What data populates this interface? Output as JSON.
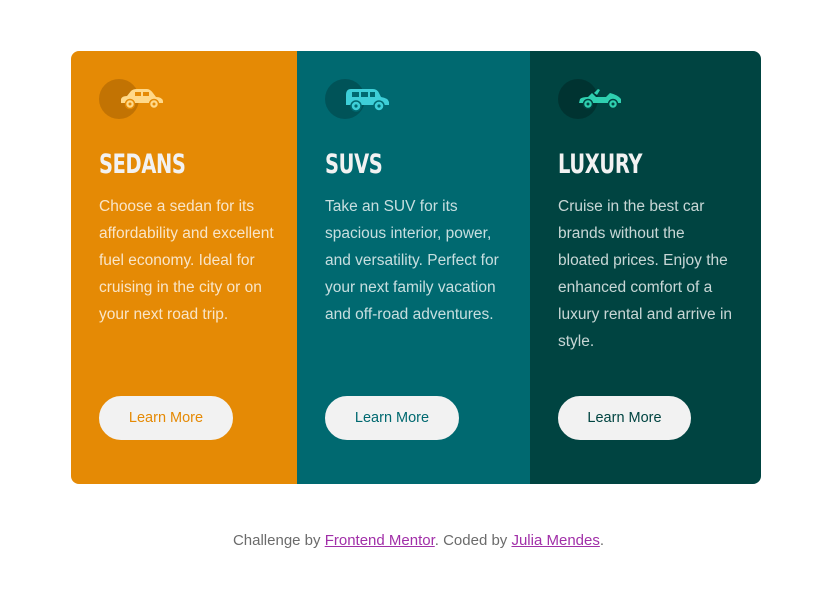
{
  "cards": [
    {
      "id": "sedans",
      "title": "SEDANS",
      "description": "Choose a sedan for its affordability and excellent fuel economy. Ideal for cruising in the city or on your next road trip.",
      "button_label": "Learn More",
      "icon": "sedan-car-icon",
      "bg_color": "#e58a05",
      "circle_color": "#b96d02",
      "icon_color": "#ffd98a",
      "button_text_color": "#e58a05"
    },
    {
      "id": "suvs",
      "title": "SUVS",
      "description": "Take an SUV for its spacious interior, power, and versatility. Perfect for your next family vacation and off-road adventures.",
      "button_label": "Learn More",
      "icon": "suv-car-icon",
      "bg_color": "#006970",
      "circle_color": "#004d52",
      "icon_color": "#3ecfd8",
      "button_text_color": "#006970"
    },
    {
      "id": "luxury",
      "title": "LUXURY",
      "description": "Cruise in the best car brands without the bloated prices. Enjoy the enhanced comfort of a luxury rental and arrive in style.",
      "button_label": "Learn More",
      "icon": "luxury-car-icon",
      "bg_color": "#004441",
      "circle_color": "#002f2d",
      "icon_color": "#2fd0b0",
      "button_text_color": "#004441"
    }
  ],
  "footer": {
    "prefix": "Challenge by ",
    "link1": "Frontend Mentor",
    "middle": ". Coded by ",
    "link2": "Julia Mendes",
    "suffix": "."
  }
}
